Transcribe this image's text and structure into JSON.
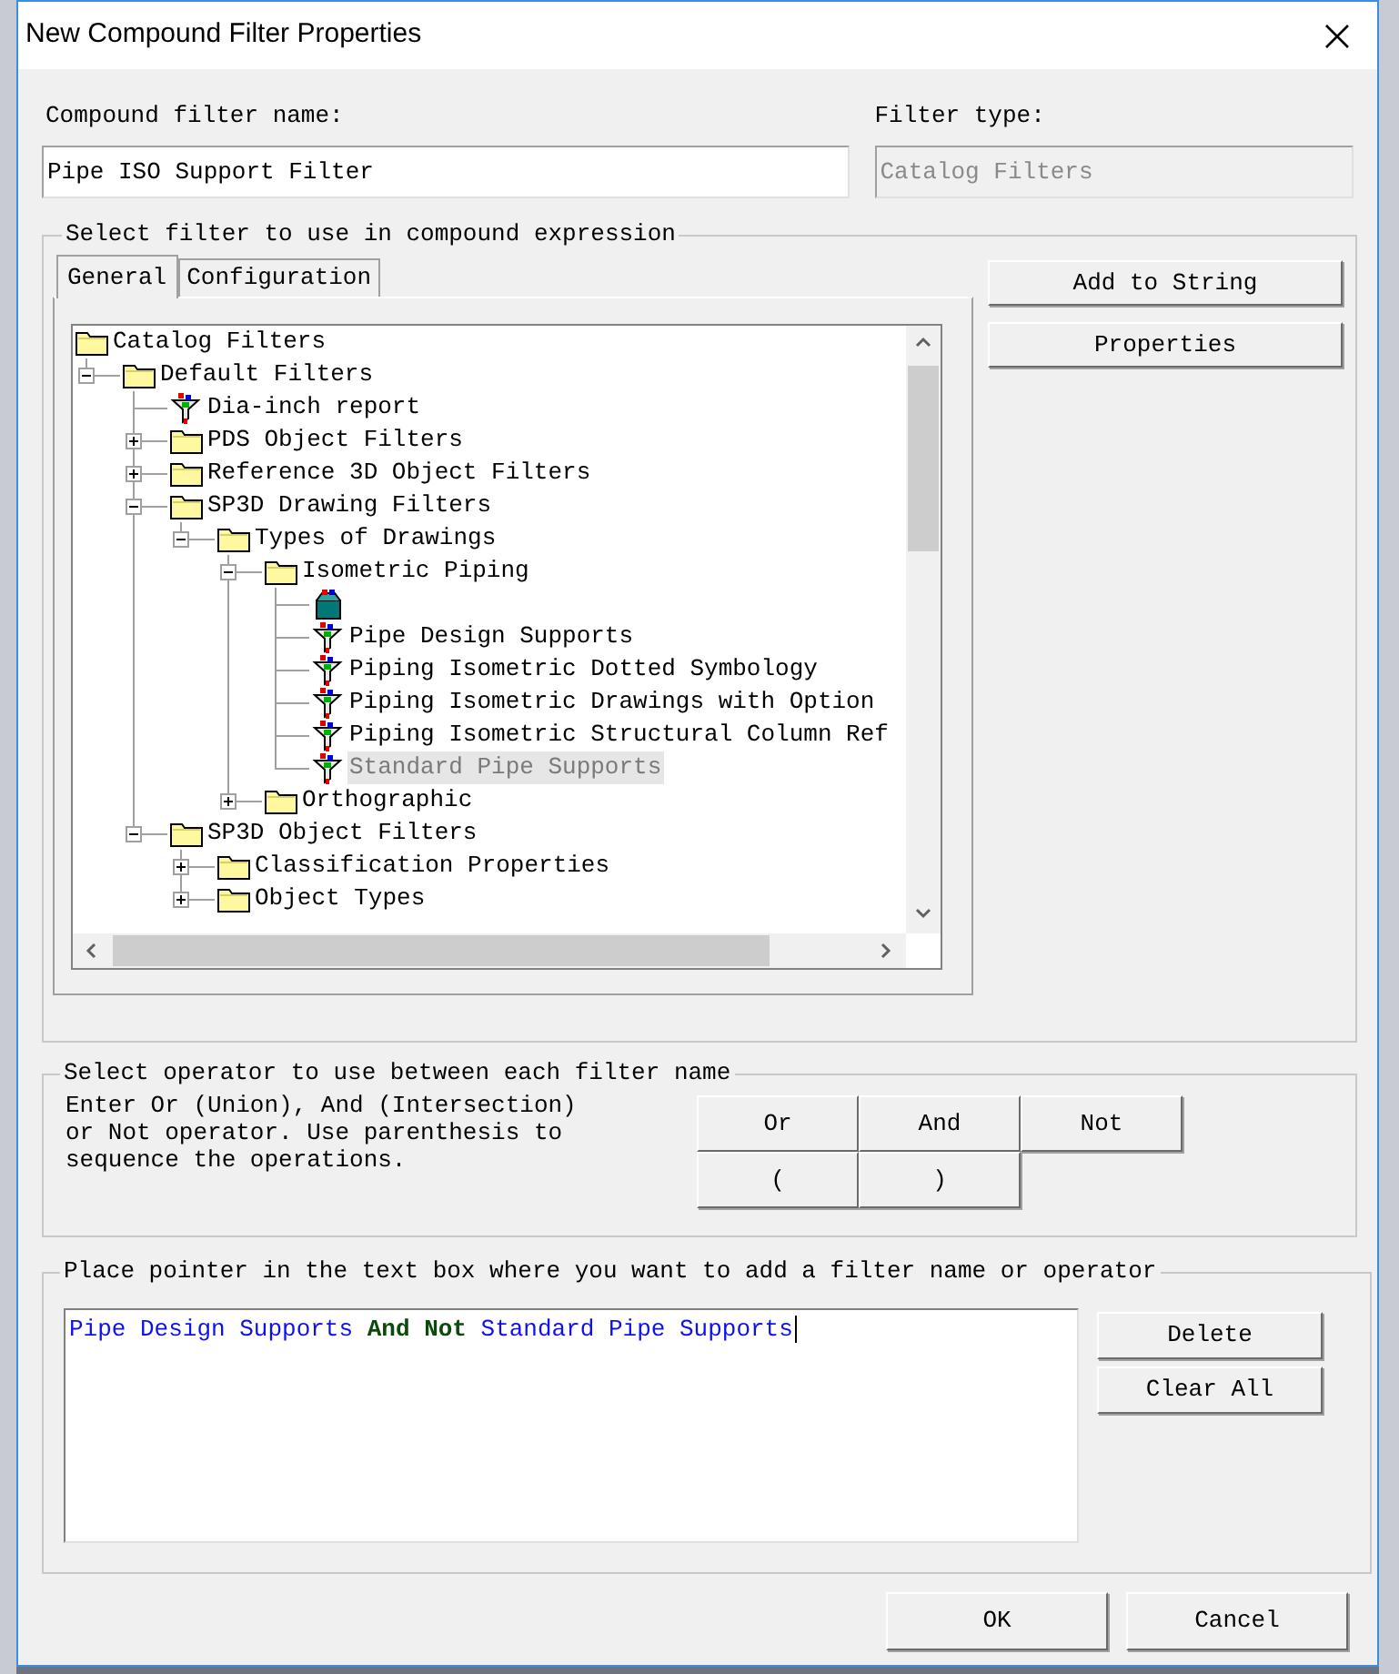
{
  "window": {
    "title": "New Compound Filter Properties"
  },
  "name_field": {
    "label": "Compound filter name:",
    "value": "Pipe ISO Support Filter"
  },
  "type_field": {
    "label": "Filter type:",
    "value": "Catalog Filters",
    "disabled": true
  },
  "filter_group": {
    "title": "Select filter to use in compound expression"
  },
  "tabs": [
    {
      "label": "General",
      "selected": true
    },
    {
      "label": "Configuration",
      "selected": false
    }
  ],
  "tree": [
    {
      "label": "Catalog Filters",
      "kind": "folder",
      "selected": false,
      "children": [
        {
          "label": "Default Filters",
          "kind": "folder",
          "expanded": true,
          "selected": false,
          "children": [
            {
              "label": "Dia-inch report",
              "kind": "filter",
              "selected": false
            },
            {
              "label": "PDS Object Filters",
              "kind": "folder",
              "expanded": false,
              "selected": false
            },
            {
              "label": "Reference 3D Object Filters",
              "kind": "folder",
              "expanded": false,
              "selected": false
            },
            {
              "label": "SP3D Drawing Filters",
              "kind": "folder",
              "expanded": true,
              "selected": false,
              "children": [
                {
                  "label": "Types of Drawings",
                  "kind": "folder",
                  "expanded": true,
                  "selected": false,
                  "children": [
                    {
                      "label": "Isometric Piping",
                      "kind": "folder",
                      "expanded": true,
                      "selected": false,
                      "children": [
                        {
                          "kind": "new-filter",
                          "selected": false
                        },
                        {
                          "label": "Pipe Design Supports",
                          "kind": "filter",
                          "selected": false
                        },
                        {
                          "label": "Piping Isometric Dotted Symbology",
                          "kind": "filter",
                          "selected": false
                        },
                        {
                          "label": "Piping Isometric Drawings with Option",
                          "kind": "filter",
                          "selected": false
                        },
                        {
                          "label": "Piping Isometric Structural Column Ref",
                          "kind": "filter",
                          "selected": false
                        },
                        {
                          "label": "Standard Pipe Supports",
                          "kind": "filter",
                          "selected": true
                        }
                      ]
                    },
                    {
                      "label": "Orthographic",
                      "kind": "folder",
                      "expanded": false,
                      "selected": false
                    }
                  ]
                }
              ]
            },
            {
              "label": "SP3D Object Filters",
              "kind": "folder",
              "expanded": true,
              "selected": false,
              "children": [
                {
                  "label": "Classification Properties",
                  "kind": "folder",
                  "expanded": false,
                  "selected": false
                },
                {
                  "label": "Object Types",
                  "kind": "folder",
                  "expanded": false,
                  "selected": false
                }
              ]
            }
          ]
        }
      ]
    }
  ],
  "side_buttons": [
    "Add to String",
    "Properties"
  ],
  "operator_group": {
    "title": "Select operator to use between each filter name",
    "description": "Enter Or (Union), And (Intersection) or Not operator. Use parenthesis to sequence the operations.",
    "buttons": [
      [
        "Or",
        "And",
        "Not"
      ],
      [
        "(",
        ")"
      ]
    ]
  },
  "expression_group": {
    "title": "Place pointer in the text box where you want to add a filter name or operator",
    "tokens": [
      {
        "text": "Pipe Design Supports",
        "kind": "filter"
      },
      {
        "text": "And",
        "kind": "operator"
      },
      {
        "text": "Not",
        "kind": "operator"
      },
      {
        "text": "Standard Pipe Supports",
        "kind": "filter"
      }
    ],
    "buttons": [
      "Delete",
      "Clear All"
    ]
  },
  "footer_buttons": [
    "OK",
    "Cancel"
  ]
}
